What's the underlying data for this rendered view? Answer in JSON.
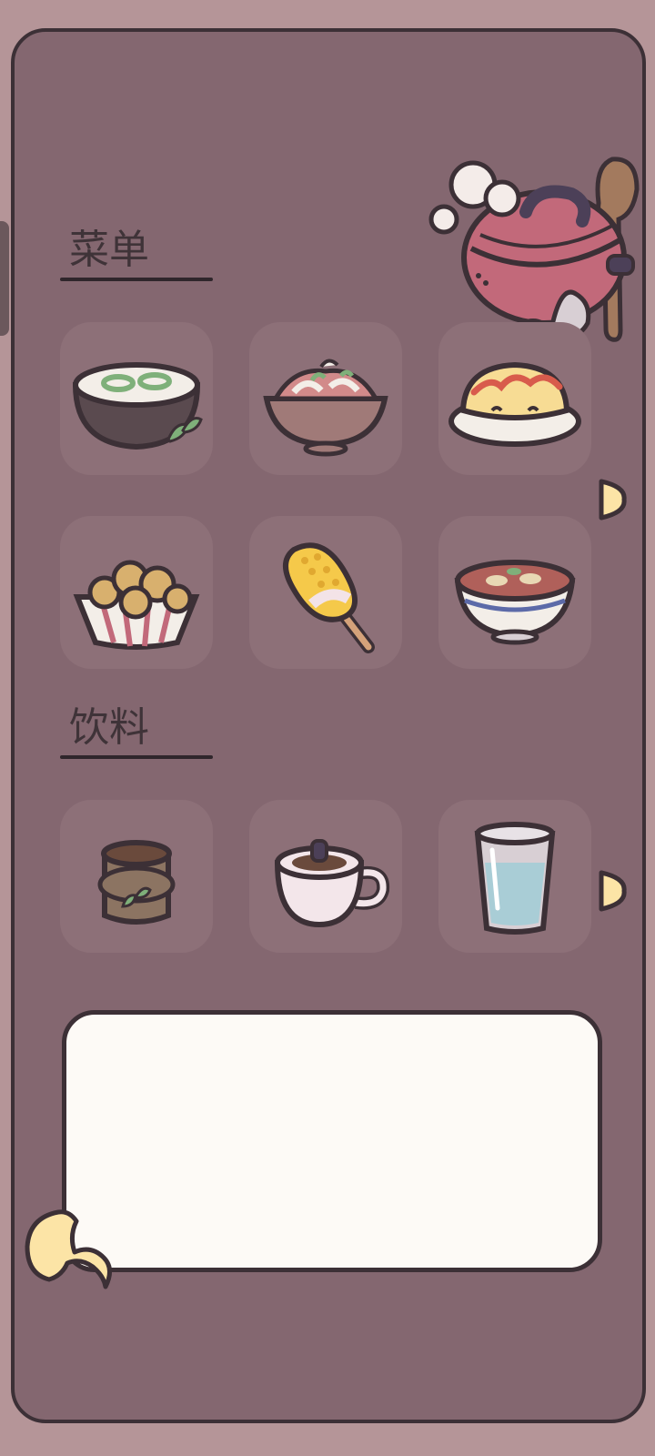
{
  "menu_section": {
    "title": "菜单",
    "items": [
      "noodle-soup-icon",
      "meat-bowl-icon",
      "omelette-rice-icon",
      "fried-chicken-icon",
      "grilled-corn-icon",
      "stew-bowl-icon"
    ]
  },
  "drinks_section": {
    "title": "饮料",
    "items": [
      "tea-cup-icon",
      "coffee-cup-icon",
      "water-glass-icon"
    ]
  },
  "dialog": {
    "text": ""
  },
  "colors": {
    "background": "#b59598",
    "panel": "#846770",
    "tile": "#8d7078",
    "outline": "#3c3036",
    "accent_yellow": "#fce4a6",
    "textbox": "#fdfaf6"
  }
}
